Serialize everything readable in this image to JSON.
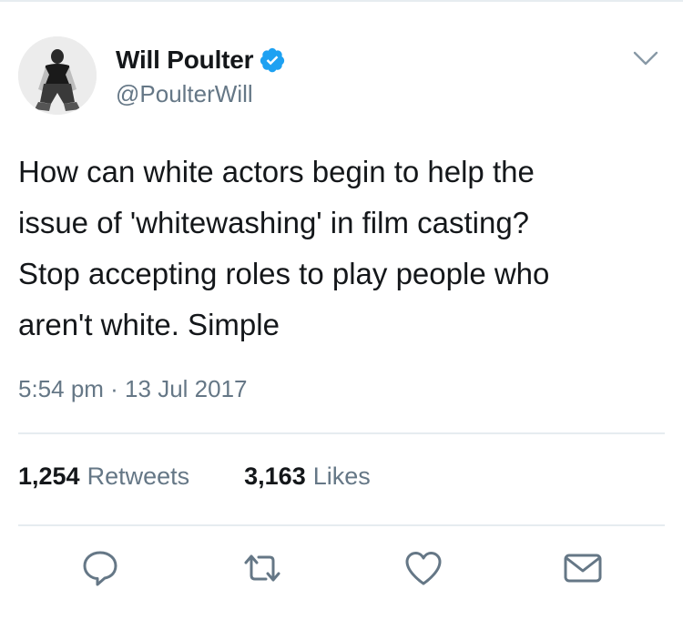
{
  "tweet": {
    "author": {
      "display_name": "Will Poulter",
      "handle": "@PoulterWill",
      "verified": true,
      "verified_icon": "verified-badge-icon",
      "verified_color": "#1da1f2"
    },
    "text": "How can white actors begin to help the\nissue of 'whitewashing' in film casting?\nStop accepting roles to play people who\naren't white. Simple",
    "timestamp": "5:54 pm · 13 Jul 2017",
    "stats": {
      "retweets_count": "1,254",
      "retweets_label": "Retweets",
      "likes_count": "3,163",
      "likes_label": "Likes"
    },
    "actions": [
      {
        "name": "reply",
        "icon": "reply-icon"
      },
      {
        "name": "retweet",
        "icon": "retweet-icon"
      },
      {
        "name": "like",
        "icon": "heart-icon"
      },
      {
        "name": "direct-message",
        "icon": "envelope-icon"
      }
    ]
  },
  "colors": {
    "text_primary": "#14171a",
    "text_secondary": "#657786",
    "divider": "#e6ecf0",
    "icon": "#657786",
    "accent": "#1da1f2"
  }
}
